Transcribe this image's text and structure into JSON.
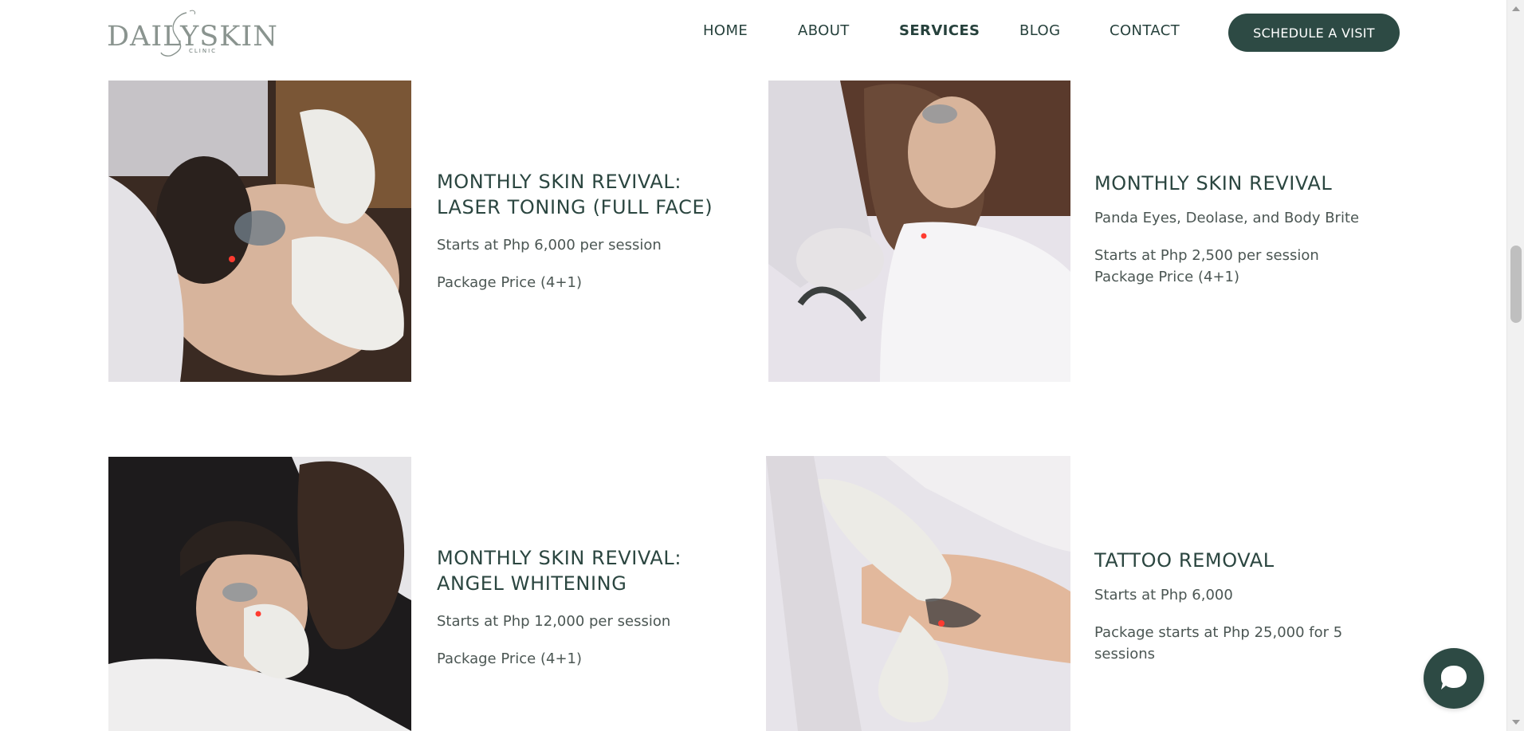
{
  "logo": {
    "main": "DAILYSKIN",
    "sub": "CLINIC"
  },
  "nav": {
    "items": [
      {
        "label": "HOME"
      },
      {
        "label": "ABOUT"
      },
      {
        "label": "SERVICES",
        "active": true
      },
      {
        "label": "BLOG"
      },
      {
        "label": "CONTACT"
      }
    ],
    "cta": "SCHEDULE A VISIT"
  },
  "services": [
    {
      "title_line1": "MONTHLY SKIN REVIVAL:",
      "title_line2": "LASER TONING (FULL FACE)",
      "price": "Starts at Php 6,000 per session",
      "package": "Package Price (4+1)"
    },
    {
      "title_line1": "MONTHLY SKIN REVIVAL",
      "subtitle": "Panda Eyes, Deolase, and Body Brite",
      "price": "Starts at Php 2,500 per session",
      "package": "Package Price (4+1)"
    },
    {
      "title_line1": "MONTHLY SKIN REVIVAL:",
      "title_line2": "ANGEL WHITENING",
      "price": "Starts at Php 12,000 per session",
      "package": "Package Price (4+1)"
    },
    {
      "title_line1": "TATTOO REMOVAL",
      "price": "Starts at Php 6,000",
      "package_line1": "Package starts at Php 25,000 for 5",
      "package_line2": "sessions"
    }
  ],
  "colors": {
    "brand_green": "#2d4a44",
    "heading": "#2b4640",
    "body_text": "#4b5653"
  },
  "icons": {
    "chat": "chat-bubble-icon"
  }
}
